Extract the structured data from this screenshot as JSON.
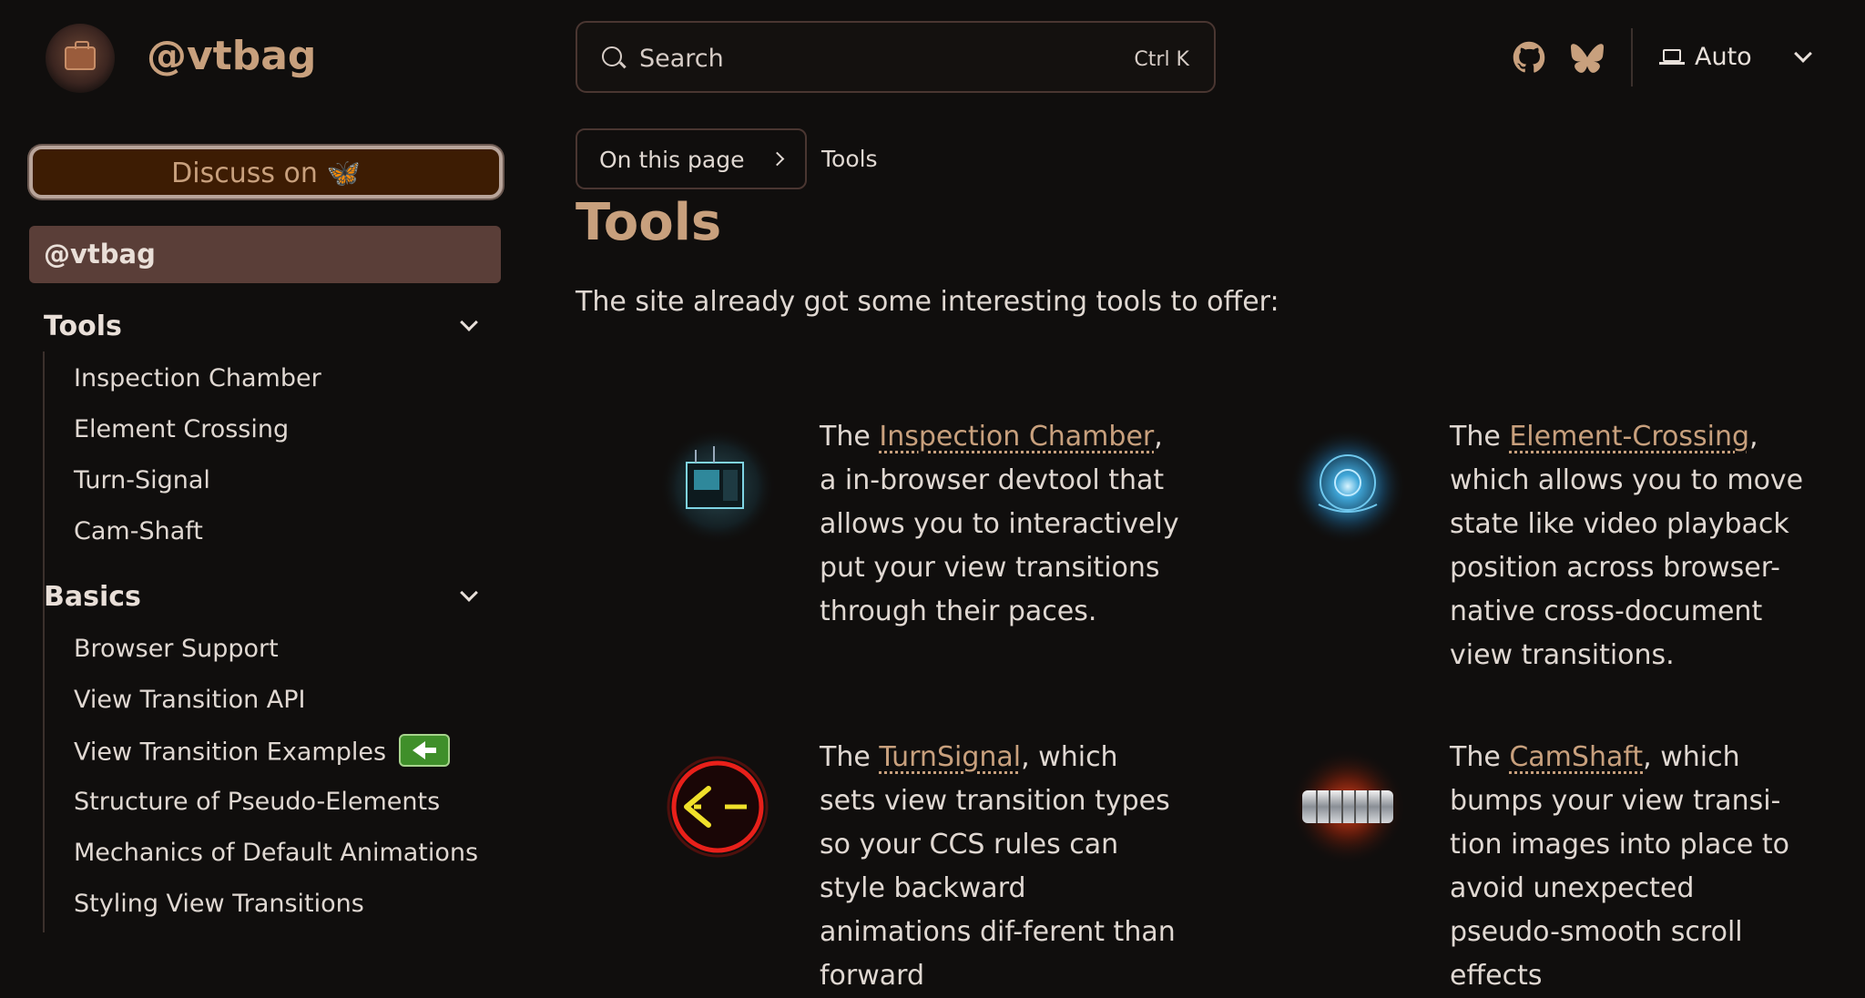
{
  "header": {
    "site_title": "@vtbag",
    "search": {
      "label": "Search",
      "shortcut": "Ctrl K"
    },
    "icons": [
      "github-icon",
      "bluesky-icon"
    ],
    "theme": {
      "label": "Auto"
    }
  },
  "sidebar": {
    "discuss_label": "Discuss on 🦋",
    "current": "@vtbag",
    "groups": [
      {
        "label": "Tools",
        "items": [
          "Inspection Chamber",
          "Element Crossing",
          "Turn-Signal",
          "Cam-Shaft"
        ]
      },
      {
        "label": "Basics",
        "items": [
          "Browser Support",
          "View Transition API",
          "View Transition Examples",
          "Structure of Pseudo-Elements",
          "Mechanics of Default Animations",
          "Styling View Transitions"
        ]
      }
    ]
  },
  "main": {
    "on_this_page": "On this page",
    "breadcrumb": "Tools",
    "title": "Tools",
    "intro": "The site already got some interesting tools to offer:",
    "tools": [
      {
        "pre": "The ",
        "link": "Inspection Chamber",
        "post": ", a in-browser devtool that allows you to interactively put your view transitions through their paces."
      },
      {
        "pre": "The ",
        "link": "Element-Crossing",
        "post": ", which allows you to move state like video playback position across browser-native cross-document view transitions."
      },
      {
        "pre": "The ",
        "link": "TurnSignal",
        "post": ", which sets view transition types so your CCS rules can style backward animations dif-ferent than forward"
      },
      {
        "pre": "The ",
        "link": "CamShaft",
        "post": ", which bumps your view transi-tion images into place to avoid unexpected pseudo-smooth scroll effects"
      }
    ]
  },
  "colors": {
    "accent": "#c8a07d",
    "background": "#100e0d",
    "current_item": "#5a3e38",
    "badge": "#3f8f2a"
  }
}
